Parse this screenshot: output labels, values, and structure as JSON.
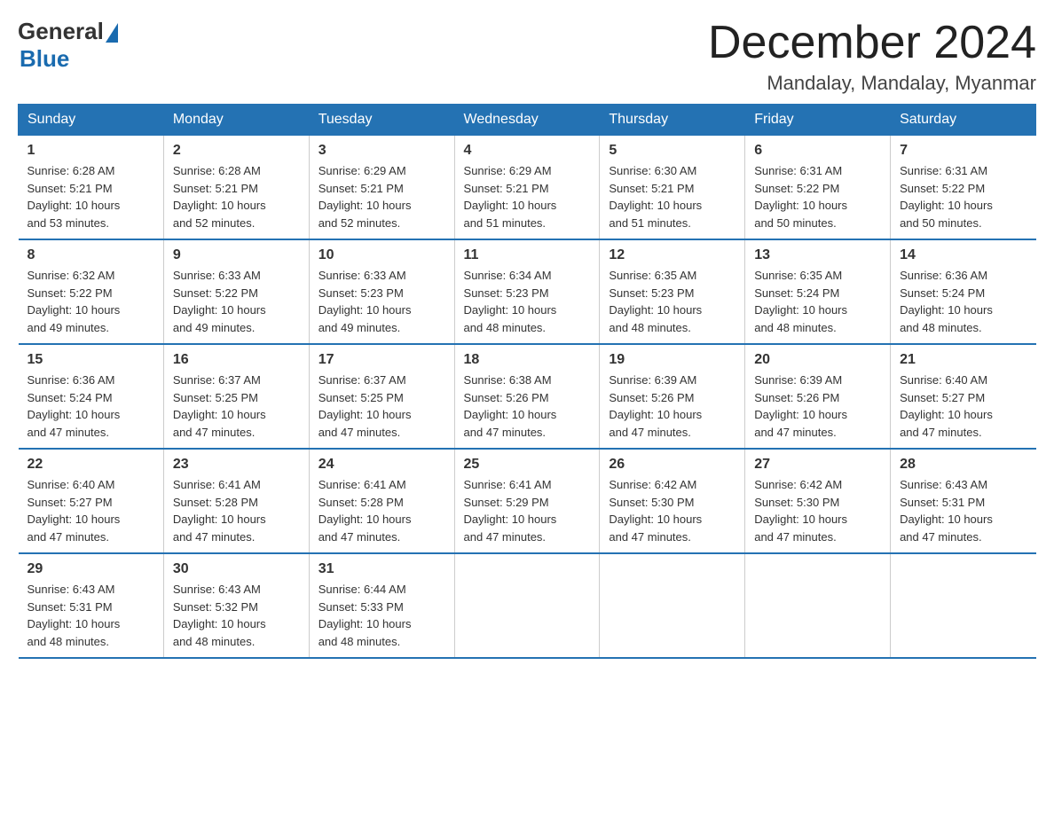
{
  "logo": {
    "general": "General",
    "blue": "Blue"
  },
  "title": {
    "month_year": "December 2024",
    "location": "Mandalay, Mandalay, Myanmar"
  },
  "days_of_week": [
    "Sunday",
    "Monday",
    "Tuesday",
    "Wednesday",
    "Thursday",
    "Friday",
    "Saturday"
  ],
  "weeks": [
    [
      {
        "day": "1",
        "sunrise": "6:28 AM",
        "sunset": "5:21 PM",
        "daylight": "10 hours and 53 minutes."
      },
      {
        "day": "2",
        "sunrise": "6:28 AM",
        "sunset": "5:21 PM",
        "daylight": "10 hours and 52 minutes."
      },
      {
        "day": "3",
        "sunrise": "6:29 AM",
        "sunset": "5:21 PM",
        "daylight": "10 hours and 52 minutes."
      },
      {
        "day": "4",
        "sunrise": "6:29 AM",
        "sunset": "5:21 PM",
        "daylight": "10 hours and 51 minutes."
      },
      {
        "day": "5",
        "sunrise": "6:30 AM",
        "sunset": "5:21 PM",
        "daylight": "10 hours and 51 minutes."
      },
      {
        "day": "6",
        "sunrise": "6:31 AM",
        "sunset": "5:22 PM",
        "daylight": "10 hours and 50 minutes."
      },
      {
        "day": "7",
        "sunrise": "6:31 AM",
        "sunset": "5:22 PM",
        "daylight": "10 hours and 50 minutes."
      }
    ],
    [
      {
        "day": "8",
        "sunrise": "6:32 AM",
        "sunset": "5:22 PM",
        "daylight": "10 hours and 49 minutes."
      },
      {
        "day": "9",
        "sunrise": "6:33 AM",
        "sunset": "5:22 PM",
        "daylight": "10 hours and 49 minutes."
      },
      {
        "day": "10",
        "sunrise": "6:33 AM",
        "sunset": "5:23 PM",
        "daylight": "10 hours and 49 minutes."
      },
      {
        "day": "11",
        "sunrise": "6:34 AM",
        "sunset": "5:23 PM",
        "daylight": "10 hours and 48 minutes."
      },
      {
        "day": "12",
        "sunrise": "6:35 AM",
        "sunset": "5:23 PM",
        "daylight": "10 hours and 48 minutes."
      },
      {
        "day": "13",
        "sunrise": "6:35 AM",
        "sunset": "5:24 PM",
        "daylight": "10 hours and 48 minutes."
      },
      {
        "day": "14",
        "sunrise": "6:36 AM",
        "sunset": "5:24 PM",
        "daylight": "10 hours and 48 minutes."
      }
    ],
    [
      {
        "day": "15",
        "sunrise": "6:36 AM",
        "sunset": "5:24 PM",
        "daylight": "10 hours and 47 minutes."
      },
      {
        "day": "16",
        "sunrise": "6:37 AM",
        "sunset": "5:25 PM",
        "daylight": "10 hours and 47 minutes."
      },
      {
        "day": "17",
        "sunrise": "6:37 AM",
        "sunset": "5:25 PM",
        "daylight": "10 hours and 47 minutes."
      },
      {
        "day": "18",
        "sunrise": "6:38 AM",
        "sunset": "5:26 PM",
        "daylight": "10 hours and 47 minutes."
      },
      {
        "day": "19",
        "sunrise": "6:39 AM",
        "sunset": "5:26 PM",
        "daylight": "10 hours and 47 minutes."
      },
      {
        "day": "20",
        "sunrise": "6:39 AM",
        "sunset": "5:26 PM",
        "daylight": "10 hours and 47 minutes."
      },
      {
        "day": "21",
        "sunrise": "6:40 AM",
        "sunset": "5:27 PM",
        "daylight": "10 hours and 47 minutes."
      }
    ],
    [
      {
        "day": "22",
        "sunrise": "6:40 AM",
        "sunset": "5:27 PM",
        "daylight": "10 hours and 47 minutes."
      },
      {
        "day": "23",
        "sunrise": "6:41 AM",
        "sunset": "5:28 PM",
        "daylight": "10 hours and 47 minutes."
      },
      {
        "day": "24",
        "sunrise": "6:41 AM",
        "sunset": "5:28 PM",
        "daylight": "10 hours and 47 minutes."
      },
      {
        "day": "25",
        "sunrise": "6:41 AM",
        "sunset": "5:29 PM",
        "daylight": "10 hours and 47 minutes."
      },
      {
        "day": "26",
        "sunrise": "6:42 AM",
        "sunset": "5:30 PM",
        "daylight": "10 hours and 47 minutes."
      },
      {
        "day": "27",
        "sunrise": "6:42 AM",
        "sunset": "5:30 PM",
        "daylight": "10 hours and 47 minutes."
      },
      {
        "day": "28",
        "sunrise": "6:43 AM",
        "sunset": "5:31 PM",
        "daylight": "10 hours and 47 minutes."
      }
    ],
    [
      {
        "day": "29",
        "sunrise": "6:43 AM",
        "sunset": "5:31 PM",
        "daylight": "10 hours and 48 minutes."
      },
      {
        "day": "30",
        "sunrise": "6:43 AM",
        "sunset": "5:32 PM",
        "daylight": "10 hours and 48 minutes."
      },
      {
        "day": "31",
        "sunrise": "6:44 AM",
        "sunset": "5:33 PM",
        "daylight": "10 hours and 48 minutes."
      },
      null,
      null,
      null,
      null
    ]
  ],
  "labels": {
    "sunrise": "Sunrise:",
    "sunset": "Sunset:",
    "daylight": "Daylight:"
  }
}
